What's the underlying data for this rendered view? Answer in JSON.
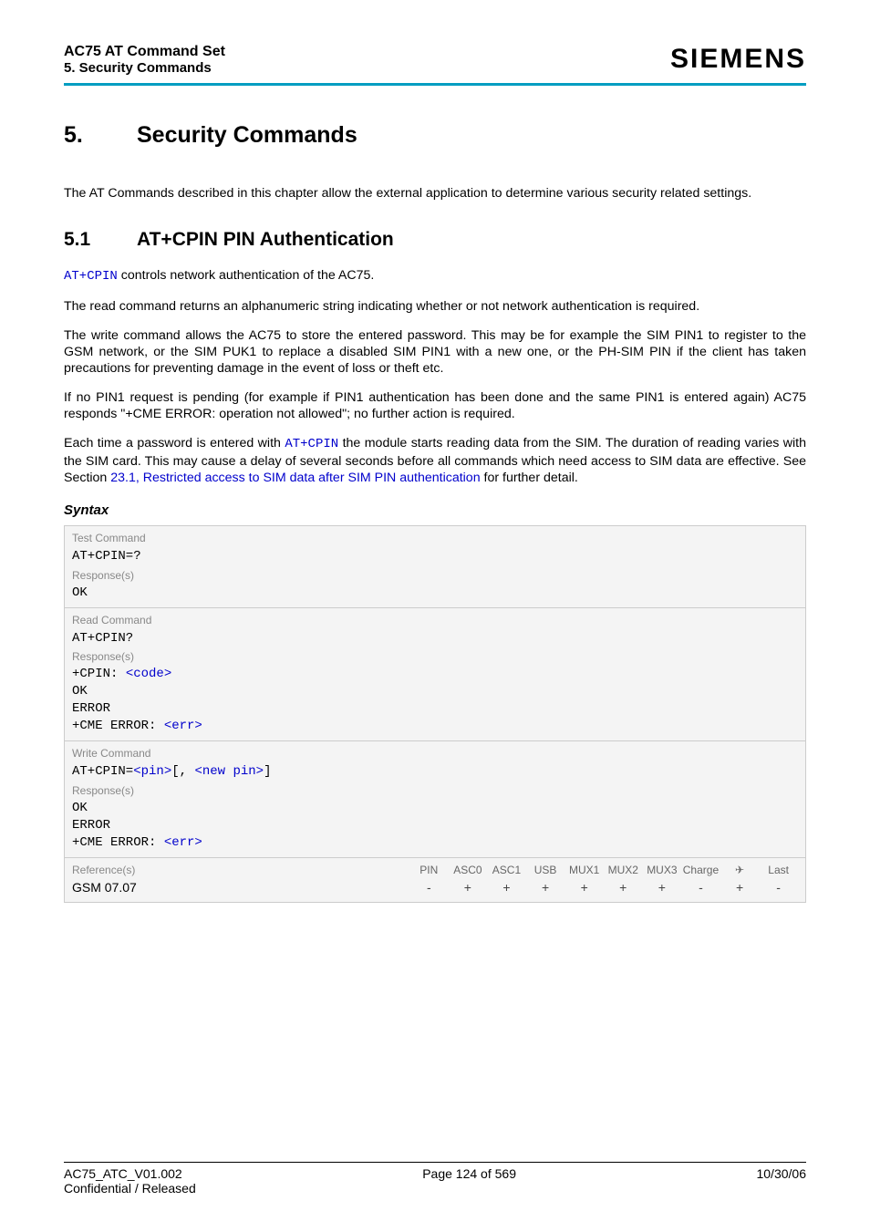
{
  "header": {
    "doc_title": "AC75 AT Command Set",
    "doc_section": "5. Security Commands",
    "brand": "SIEMENS"
  },
  "h1": {
    "num": "5.",
    "text": "Security Commands"
  },
  "intro": "The AT Commands described in this chapter allow the external application to determine various security related settings.",
  "h2": {
    "num": "5.1",
    "text": "AT+CPIN   PIN Authentication"
  },
  "p1_a": "AT+CPIN",
  "p1_b": " controls network authentication of the AC75.",
  "p2": "The read command returns an alphanumeric string indicating whether or not network authentication is required.",
  "p3": "The write command allows the AC75 to store the entered password. This may be for example the SIM PIN1 to register to the GSM network, or the SIM PUK1 to replace a disabled SIM PIN1 with a new one, or the PH-SIM PIN if the client has taken precautions for preventing damage in the event of loss or theft etc.",
  "p4": "If no PIN1 request is pending (for example if PIN1 authentication has been done and the same PIN1 is entered again) AC75 responds \"+CME ERROR: operation not allowed\"; no further action is required.",
  "p5_a": "Each time a password is entered with ",
  "p5_b": "AT+CPIN",
  "p5_c": " the module starts reading data from the SIM. The duration of reading varies with the SIM card. This may cause a delay of several seconds before all commands which need access to SIM data are effective. See Section ",
  "p5_d": "23.1, Restricted access to SIM data after SIM PIN authentication",
  "p5_e": " for further detail.",
  "syntax_label": "Syntax",
  "syntax": {
    "test": {
      "label": "Test Command",
      "cmd": "AT+CPIN=?",
      "resp_label": "Response(s)",
      "resp": "OK"
    },
    "read": {
      "label": "Read Command",
      "cmd": "AT+CPIN?",
      "resp_label": "Response(s)",
      "r1a": "+CPIN: ",
      "r1b": "<code>",
      "r2": "OK",
      "r3": "ERROR",
      "r4a": "+CME ERROR: ",
      "r4b": "<err>"
    },
    "write": {
      "label": "Write Command",
      "c1": "AT+CPIN=",
      "c2": "<pin>",
      "c3": "[, ",
      "c4": "<new pin>",
      "c5": "]",
      "resp_label": "Response(s)",
      "r1": "OK",
      "r2": "ERROR",
      "r3a": "+CME ERROR: ",
      "r3b": "<err>"
    },
    "ref": {
      "label": "Reference(s)",
      "value": "GSM 07.07",
      "cols": [
        "PIN",
        "ASC0",
        "ASC1",
        "USB",
        "MUX1",
        "MUX2",
        "MUX3",
        "Charge",
        "✈",
        "Last"
      ],
      "vals": [
        "-",
        "+",
        "+",
        "+",
        "+",
        "+",
        "+",
        "-",
        "+",
        "-"
      ]
    }
  },
  "footer": {
    "left": "AC75_ATC_V01.002",
    "center": "Page 124 of 569",
    "right": "10/30/06",
    "left2": "Confidential / Released"
  }
}
